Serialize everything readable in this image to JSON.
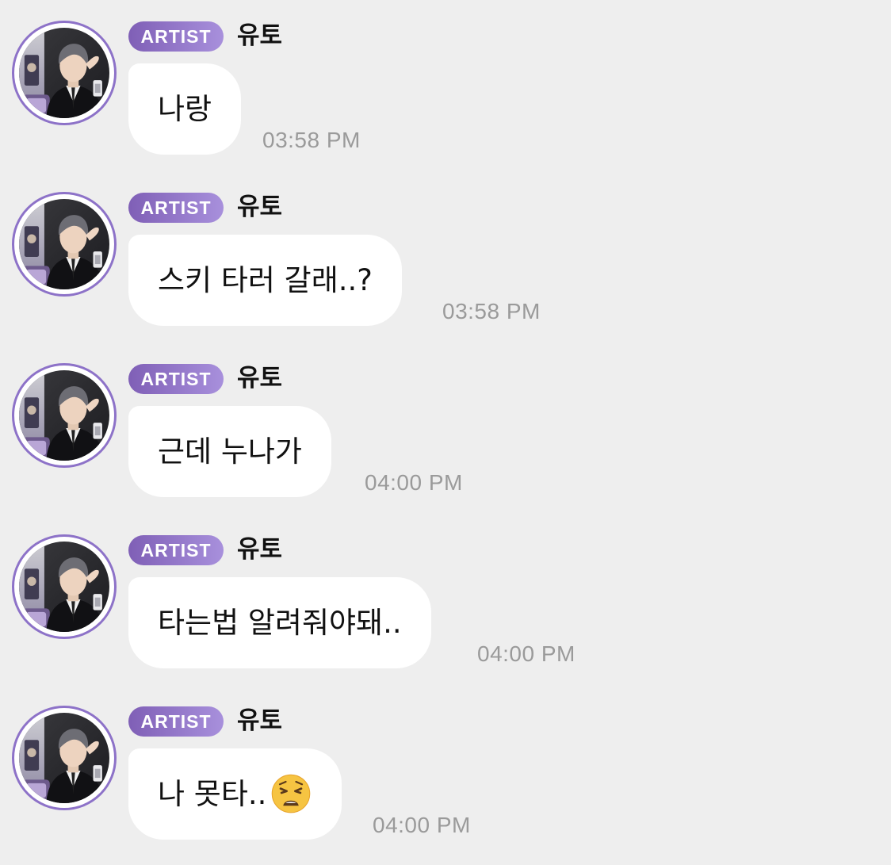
{
  "colors": {
    "background": "#eeeeee",
    "bubble": "#ffffff",
    "badge_start": "#7f5fb6",
    "badge_end": "#a890dc",
    "avatar_ring": "#8d72c8",
    "timestamp": "#9a9a9a"
  },
  "messages": [
    {
      "badge": "ARTIST",
      "sender": "유토",
      "text": "나랑",
      "time": "03:58 PM"
    },
    {
      "badge": "ARTIST",
      "sender": "유토",
      "text": "스키 타러 갈래..?",
      "time": "03:58 PM"
    },
    {
      "badge": "ARTIST",
      "sender": "유토",
      "text": "근데 누나가",
      "time": "04:00 PM"
    },
    {
      "badge": "ARTIST",
      "sender": "유토",
      "text": "타는법 알려줘야돼..",
      "time": "04:00 PM"
    },
    {
      "badge": "ARTIST",
      "sender": "유토",
      "text": "나 못타..",
      "emoji": "weary-face-icon",
      "time": "04:00 PM"
    }
  ]
}
